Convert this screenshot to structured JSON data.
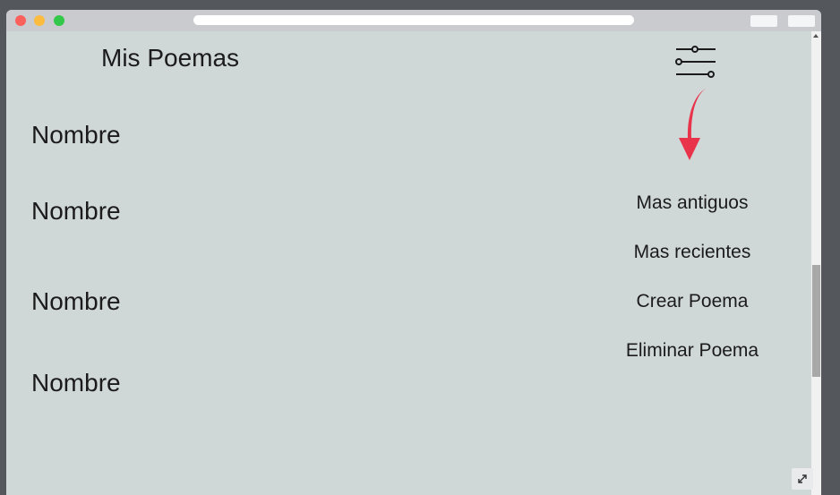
{
  "header": {
    "title": "Mis Poemas"
  },
  "poems": [
    {
      "label": "Nombre"
    },
    {
      "label": "Nombre"
    },
    {
      "label": "Nombre"
    },
    {
      "label": "Nombre"
    }
  ],
  "filter_menu": {
    "icon": "sliders-icon",
    "items": [
      {
        "label": "Mas antiguos"
      },
      {
        "label": "Mas recientes"
      },
      {
        "label": "Crear Poema"
      },
      {
        "label": "Eliminar Poema"
      }
    ]
  },
  "colors": {
    "background": "#d0d8d7",
    "arrow": "#e8334b",
    "text": "#1b1b1b"
  }
}
